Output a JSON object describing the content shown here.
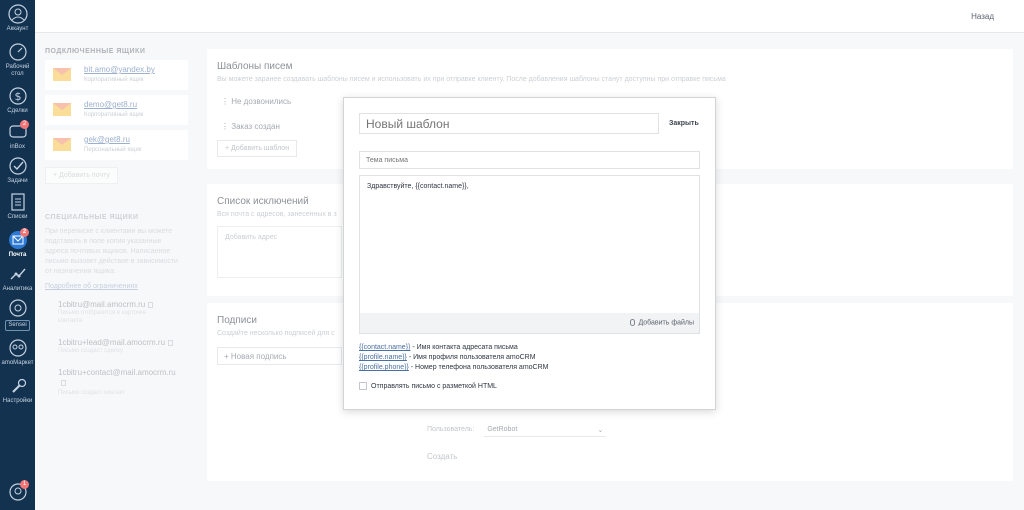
{
  "nav": {
    "items": [
      {
        "label": "Аккаунт",
        "icon": "avatar-icon"
      },
      {
        "label": "Рабочий стол",
        "icon": "speedometer-icon"
      },
      {
        "label": "Сделки",
        "icon": "dollar-icon"
      },
      {
        "label": "inBox",
        "icon": "chat-icon",
        "badge": "2"
      },
      {
        "label": "Задачи",
        "icon": "checkmark-icon"
      },
      {
        "label": "Списки",
        "icon": "list-icon"
      },
      {
        "label": "Почта",
        "icon": "mail-icon",
        "badge": "2",
        "active": true
      },
      {
        "label": "Аналитика",
        "icon": "chart-icon"
      },
      {
        "label": "Sensei",
        "icon": "gear-icon"
      },
      {
        "label": "amoМаркет",
        "icon": "market-icon"
      },
      {
        "label": "Настройки",
        "icon": "wrench-icon"
      }
    ],
    "bottom_badge": "1"
  },
  "topbar": {
    "back_label": "Назад"
  },
  "connected": {
    "heading": "ПОДКЛЮЧЕННЫЕ ЯЩИКИ",
    "boxes": [
      {
        "address": "bit.amo@yandex.by",
        "kind": "Корпоративный ящик"
      },
      {
        "address": "demo@get8.ru",
        "kind": "Корпоративный ящик"
      },
      {
        "address": "gek@get8.ru",
        "kind": "Персональный ящик"
      }
    ],
    "add_label": "Добавить почту"
  },
  "special": {
    "heading": "СПЕЦИАЛЬНЫЕ ЯЩИКИ",
    "text": "При переписке с клиентами вы можете подставить в поле копия указанные адреса почтовых ящиков. Написанное письмо вызовет действие в зависимости от назначения ящика.",
    "link": "Подробнее об ограничениях",
    "robots": [
      {
        "address": "1cbitru@mail.amocrm.ru",
        "note": "Письмо отобразится в карточке контакта"
      },
      {
        "address": "1cbitru+lead@mail.amocrm.ru",
        "note": "Письмо создаст сделку"
      },
      {
        "address": "1cbitru+contact@mail.amocrm.ru",
        "note": "Письмо создаст контакт"
      }
    ]
  },
  "templates_card": {
    "title": "Шаблоны писем",
    "subtitle": "Вы можете заранее создавать шаблоны писем и использовать их при отправке клиенту. После добавления шаблоны станут доступны при отправке письма",
    "items": [
      "Не дозвонились",
      "Заказ создан"
    ],
    "add_label": "Добавить шаблон"
  },
  "exclusions_card": {
    "title": "Список исключений",
    "subtitle": "Вся почта с адресов, занесенных в з",
    "placeholder": "Добавить адрес"
  },
  "signatures_card": {
    "title": "Подписи",
    "subtitle": "Создайте несколько подписей для с",
    "new_label": "Новая подпись",
    "user_label": "Пользователь:",
    "user_value": "GetRobot",
    "create_label": "Создать"
  },
  "modal": {
    "name_placeholder": "Новый шаблон",
    "close_label": "Закрыть",
    "subject_placeholder": "Тема письма",
    "body_text": "Здравствуйте, {{contact.name}},",
    "attach_label": "Добавить файлы",
    "variables": [
      {
        "token": "{{contact.name}}",
        "desc": " - Имя контакта адресата письма"
      },
      {
        "token": "{{profile.name}}",
        "desc": "  - Имя профиля пользователя amoCRM"
      },
      {
        "token": "{{profile.phone}}",
        "desc": " - Номер телефона пользователя amoCRM"
      }
    ],
    "html_checkbox_label": "Отправлять письмо с разметкой HTML"
  }
}
